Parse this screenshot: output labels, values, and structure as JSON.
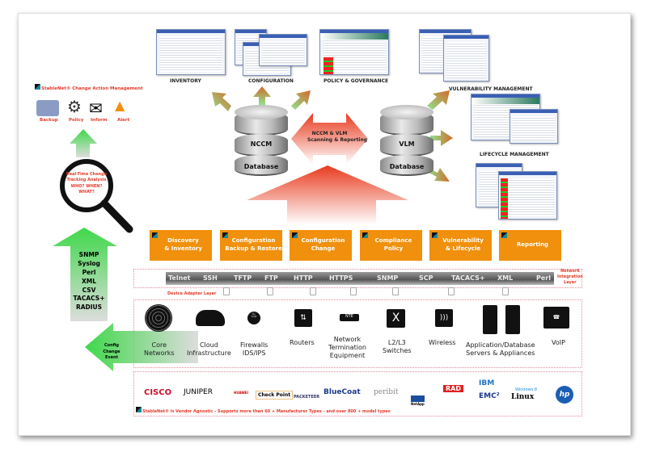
{
  "top_screens": {
    "inventory": "INVENTORY",
    "configuration": "CONFIGURATION",
    "policy": "POLICY & GOVERNANCE",
    "vulnerability": "VULNERABILITY MANAGEMENT",
    "lifecycle": "LIFECYCLE MANAGEMENT"
  },
  "databases": {
    "nccm_name": "NCCM",
    "nccm_sub": "Database",
    "vlm_name": "VLM",
    "vlm_sub": "Database",
    "link_line1": "NCCM & VLM",
    "link_line2": "Scanning & Reporting"
  },
  "action_mgmt": {
    "title": "StableNet® Change Action Management",
    "items": [
      {
        "label": "Backup",
        "icon": "folder-clock-icon"
      },
      {
        "label": "Policy",
        "icon": "gear-icon"
      },
      {
        "label": "Inform",
        "icon": "envelope-icon"
      },
      {
        "label": "Alert",
        "icon": "warning-icon"
      }
    ]
  },
  "tracking": {
    "line1": "Real-Time Change",
    "line2": "Tracking Analysis",
    "line3": "WHO? WHEN?",
    "line4": "WHAT?"
  },
  "feeds": [
    "SNMP",
    "Syslog",
    "Perl",
    "XML",
    "CSV",
    "TACACS+",
    "RADIUS"
  ],
  "config_event": {
    "line1": "Config Change",
    "line2": "Event"
  },
  "modules": [
    {
      "l1": "Discovery",
      "l2": "& Inventory"
    },
    {
      "l1": "Configuration",
      "l2": "Backup & Restore"
    },
    {
      "l1": "Configuration",
      "l2": "Change"
    },
    {
      "l1": "Compliance",
      "l2": "Policy"
    },
    {
      "l1": "Vulnerability",
      "l2": "& Lifecycle"
    },
    {
      "l1": "Reporting",
      "l2": ""
    }
  ],
  "integration": {
    "protocols": [
      "Telnet",
      "SSH",
      "TFTP",
      "FTP",
      "HTTP",
      "HTTPS",
      "SNMP",
      "SCP",
      "TACACS+",
      "XML",
      "Perl"
    ],
    "label_l1": "Network",
    "label_l2": "Integration",
    "label_l3": "Layer",
    "adapter_label": "Device Adapter Layer"
  },
  "devices": [
    {
      "l1": "Core",
      "l2": "Networks",
      "icon": "globe-icon"
    },
    {
      "l1": "Cloud",
      "l2": "Infrastructure",
      "icon": "cloud-icon"
    },
    {
      "l1": "Firewalls",
      "l2": "IDS/IPS",
      "icon": "firewall-icon"
    },
    {
      "l1": "Routers",
      "l2": "",
      "icon": "router-icon"
    },
    {
      "l1": "Network",
      "l2": "Termination",
      "l3": "Equipment",
      "icon": "nte-icon"
    },
    {
      "l1": "L2/L3",
      "l2": "Switches",
      "icon": "switch-icon"
    },
    {
      "l1": "Wireless",
      "l2": "",
      "icon": "wireless-icon"
    },
    {
      "l1": "Application/Database",
      "l2": "Servers & Appliances",
      "icon": "server-icon"
    },
    {
      "l1": "VoIP",
      "l2": "",
      "icon": "voip-phone-icon"
    }
  ],
  "vendors": {
    "names": [
      "CISCO",
      "JUNIPER",
      "HUAWEI",
      "Check Point",
      "PACKETEER",
      "BlueCoat",
      "peribit",
      "NetApp",
      "RAD",
      "IBM",
      "EMC²",
      "Windows 8",
      "Linux",
      "hp"
    ],
    "footer": "StableNet® is Vendor Agnostic - Supports more than 60 + Manufacturer Types - and over 800 + model types"
  },
  "colors": {
    "orange": "#f0900c",
    "red_text": "#e53b2a",
    "green_arrow": "#4cd964"
  }
}
